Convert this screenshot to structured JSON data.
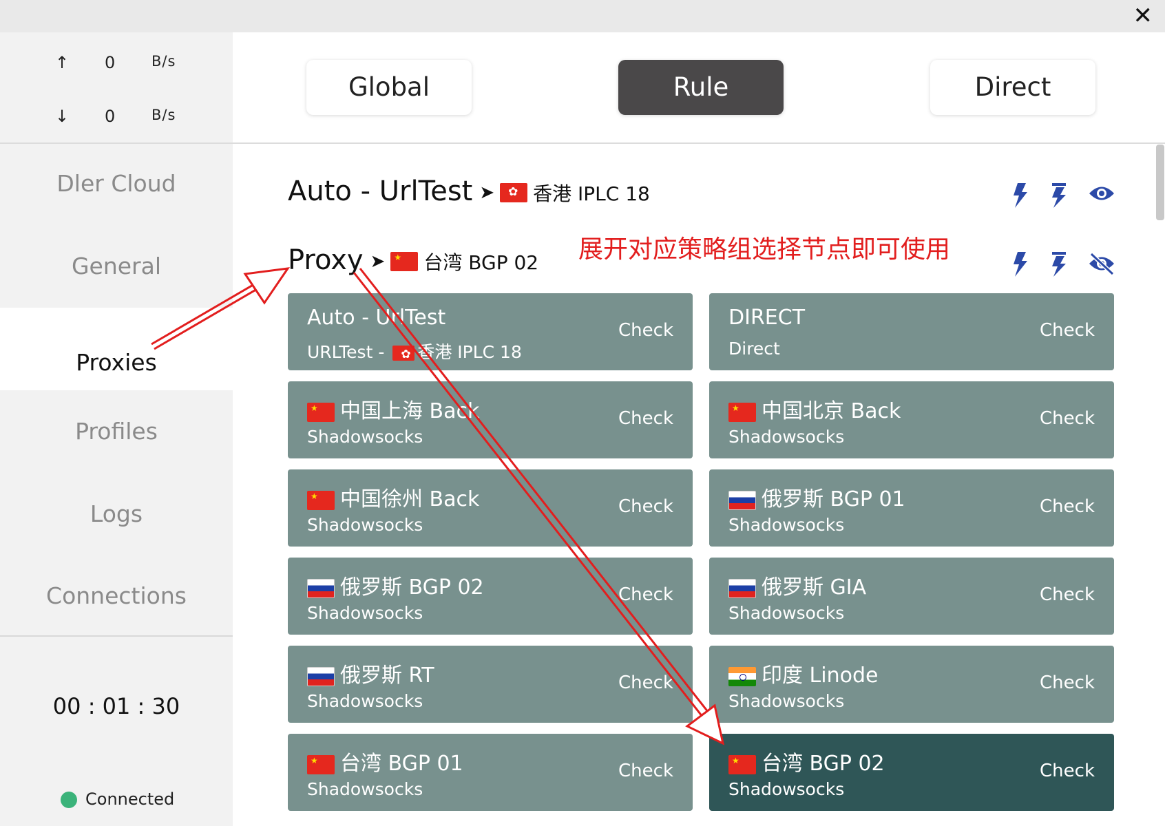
{
  "window": {
    "close_icon": "✕"
  },
  "traffic": {
    "up_arrow": "↑",
    "up_value": "0",
    "up_unit": "B/s",
    "down_arrow": "↓",
    "down_value": "0",
    "down_unit": "B/s"
  },
  "sidebar": {
    "items": [
      {
        "label": "Dler Cloud"
      },
      {
        "label": "General"
      },
      {
        "label": "Proxies"
      },
      {
        "label": "Profiles"
      },
      {
        "label": "Logs"
      },
      {
        "label": "Connections"
      }
    ],
    "active_item": "Proxies",
    "timer": "00 : 01 : 30",
    "status": "Connected",
    "status_color": "#3bb37a"
  },
  "modes": {
    "global": "Global",
    "rule": "Rule",
    "direct": "Direct",
    "active": "Rule"
  },
  "groups": [
    {
      "name": "Auto - UrlTest",
      "arrow": "➤",
      "selected": "香港 IPLC 18",
      "flag": "hk",
      "expanded": false
    },
    {
      "name": "Proxy",
      "arrow": "➤",
      "selected": "台湾 BGP 02",
      "flag": "cn",
      "expanded": true
    }
  ],
  "annotation": "展开对应策略组选择节点即可使用",
  "annotation_color": "#e21e1e",
  "check_label": "Check",
  "proxies": [
    {
      "name": "Auto - UrlTest",
      "type": "URLTest - ",
      "type_sel": "香港 IPLC 18",
      "flag": ""
    },
    {
      "name": "DIRECT",
      "type": "Direct",
      "flag": ""
    },
    {
      "name": "中国上海 Back",
      "type": "Shadowsocks",
      "flag": "cn"
    },
    {
      "name": "中国北京 Back",
      "type": "Shadowsocks",
      "flag": "cn"
    },
    {
      "name": "中国徐州 Back",
      "type": "Shadowsocks",
      "flag": "cn"
    },
    {
      "name": "俄罗斯 BGP 01",
      "type": "Shadowsocks",
      "flag": "ru"
    },
    {
      "name": "俄罗斯 BGP 02",
      "type": "Shadowsocks",
      "flag": "ru"
    },
    {
      "name": "俄罗斯 GIA",
      "type": "Shadowsocks",
      "flag": "ru"
    },
    {
      "name": "俄罗斯 RT",
      "type": "Shadowsocks",
      "flag": "ru"
    },
    {
      "name": "印度 Linode",
      "type": "Shadowsocks",
      "flag": "in"
    },
    {
      "name": "台湾 BGP 01",
      "type": "Shadowsocks",
      "flag": "cn"
    },
    {
      "name": "台湾 BGP 02",
      "type": "Shadowsocks",
      "flag": "cn",
      "selected": true
    }
  ],
  "colors": {
    "card": "#78918e",
    "card_selected": "#2f5657",
    "icons": "#2c4aa8",
    "mode_active": "#4a4849"
  }
}
